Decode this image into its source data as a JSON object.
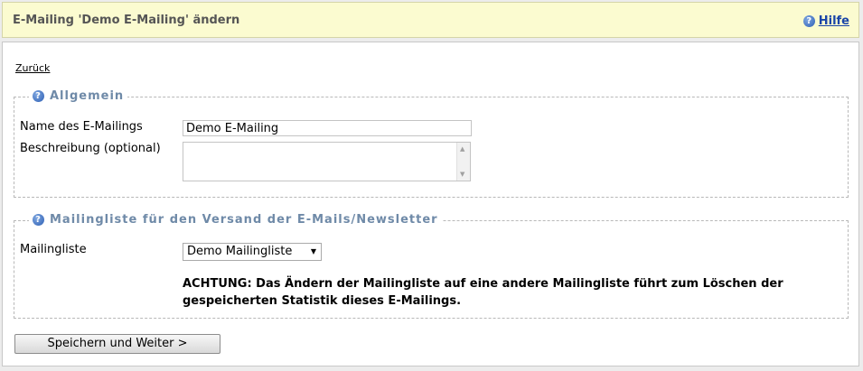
{
  "header": {
    "title": "E-Mailing 'Demo E-Mailing' ändern",
    "help_label": "Hilfe"
  },
  "nav": {
    "back_label": "Zurück"
  },
  "general": {
    "legend": "Allgemein",
    "name_label": "Name des E-Mailings",
    "name_value": "Demo E-Mailing",
    "description_label": "Beschreibung (optional)",
    "description_value": ""
  },
  "mailinglist": {
    "legend": "Mailingliste für den Versand der E-Mails/Newsletter",
    "label": "Mailingliste",
    "selected": "Demo Mailingliste",
    "warning": "ACHTUNG: Das Ändern der Mailingliste auf eine andere Mailingliste führt zum Löschen der gespeicherten Statistik dieses E-Mailings."
  },
  "actions": {
    "save_label": "Speichern und Weiter >"
  },
  "icons": {
    "help": "question-circle-icon",
    "dropdown": "triangle-down-icon"
  },
  "colors": {
    "header_bg": "#fbfbd0",
    "legend_text": "#6f8aa8",
    "link": "#1a45a8"
  }
}
